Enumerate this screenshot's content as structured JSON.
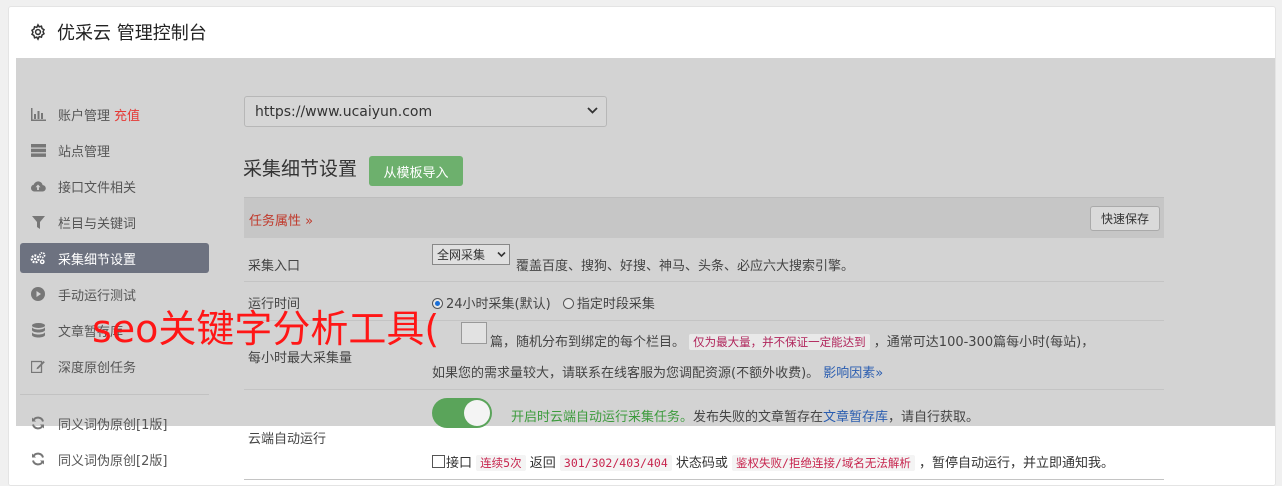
{
  "header": {
    "title": "优采云 管理控制台",
    "icon": "gear-icon"
  },
  "sidebar": {
    "items": [
      {
        "label": "账户管理",
        "extra": "充值",
        "icon": "bar-chart-icon"
      },
      {
        "label": "站点管理",
        "icon": "server-icon"
      },
      {
        "label": "接口文件相关",
        "icon": "cloud-upload-icon"
      },
      {
        "label": "栏目与关键词",
        "icon": "filter-icon"
      },
      {
        "label": "采集细节设置",
        "icon": "cogs-icon"
      },
      {
        "label": "手动运行测试",
        "icon": "play-circle-icon"
      },
      {
        "label": "文章暂存库",
        "icon": "database-icon"
      },
      {
        "label": "深度原创任务",
        "icon": "edit-icon"
      },
      {
        "label": "同义词伪原创[1版]",
        "icon": "refresh-icon"
      },
      {
        "label": "同义词伪原创[2版]",
        "icon": "refresh-icon"
      }
    ]
  },
  "main": {
    "site_select": "https://www.ucaiyun.com",
    "section_title": "采集细节设置",
    "import_button": "从模板导入",
    "task_props": "任务属性 »",
    "quick_save": "快速保存",
    "rows": {
      "entry": {
        "label": "采集入口",
        "select": "全网采集",
        "desc": "覆盖百度、搜狗、好搜、神马、头条、必应六大搜索引擎。"
      },
      "time": {
        "label": "运行时间",
        "opt1": "24小时采集(默认)",
        "opt2": "指定时段采集"
      },
      "count": {
        "label": "每小时最大采集量",
        "t1": "篇，随机分布到绑定的每个栏目。",
        "code": "仅为最大量，并不保证一定能达到",
        "t2": "，通常可达100-300篇每小时(每站)，",
        "t3": "如果您的需求量较大，请联系在线客服为您调配资源(不额外收费)。",
        "link": "影响因素»"
      },
      "cloud": {
        "label": "云端自动运行",
        "desc1": "开启时云端自动运行采集任务。",
        "desc2": "发布失败的文章暂存在",
        "link": "文章暂存库",
        "desc3": "，请自行获取。",
        "c1": "接口",
        "code1": "连续5次",
        "c2": "返回",
        "code2": "301/302/403/404",
        "c3": "状态码或",
        "code3": "鉴权失败/拒绝连接/域名无法解析",
        "c4": "，暂停自动运行，并立即通知我。"
      }
    }
  },
  "overlay_text": "seo关键字分析工具(",
  "colors": {
    "active_bg": "#6d7280",
    "accent_red": "#e53935",
    "import_green": "#6db06d",
    "toggle_green": "#5aa45a"
  }
}
